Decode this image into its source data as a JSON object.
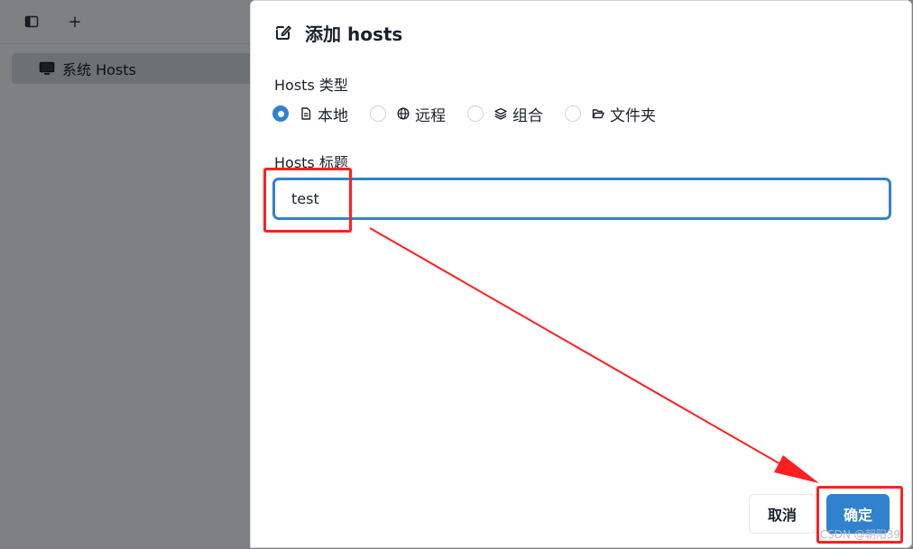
{
  "sidebar": {
    "item_label": "系统 Hosts",
    "item_icon": "monitor-icon"
  },
  "toolbar": {
    "layout_icon": "sidebar-layout-icon",
    "add_label": "+"
  },
  "dialog": {
    "title": "添加 hosts",
    "title_icon": "edit-icon",
    "type_label": "Hosts 类型",
    "type_options": [
      {
        "label": "本地",
        "icon": "file-icon",
        "checked": true
      },
      {
        "label": "远程",
        "icon": "globe-icon",
        "checked": false
      },
      {
        "label": "组合",
        "icon": "layers-icon",
        "checked": false
      },
      {
        "label": "文件夹",
        "icon": "folder-open-icon",
        "checked": false
      }
    ],
    "title_field_label": "Hosts 标题",
    "title_value": "test",
    "cancel_label": "取消",
    "ok_label": "确定"
  },
  "watermark": "CSDN @朝阳39",
  "colors": {
    "accent": "#3182ce",
    "annotation": "#ff1f1f",
    "overlay": "rgba(0,0,0,0.48)"
  }
}
